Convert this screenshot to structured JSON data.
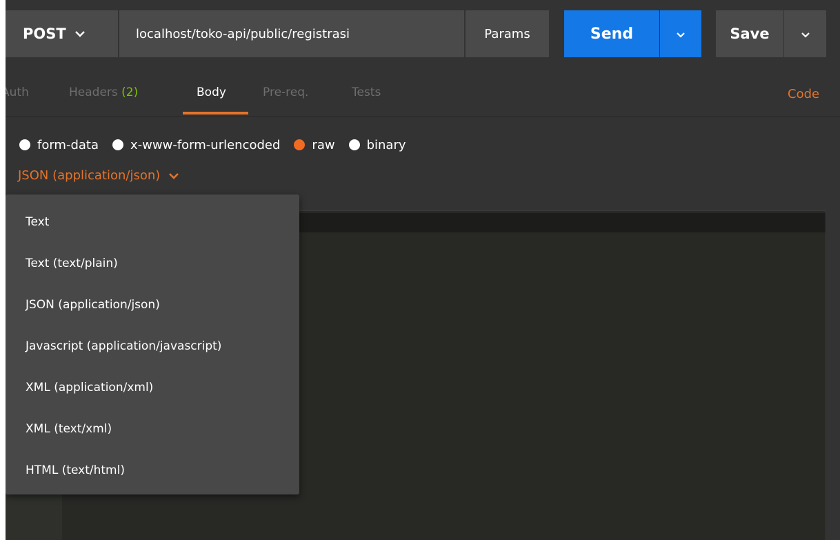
{
  "request": {
    "method": "POST",
    "url": "localhost/toko-api/public/registrasi",
    "params_label": "Params",
    "send_label": "Send",
    "save_label": "Save"
  },
  "tabs": {
    "auth": "Auth",
    "headers": "Headers",
    "headers_count": "(2)",
    "body": "Body",
    "prereq": "Pre-req.",
    "tests": "Tests",
    "code": "Code",
    "active": "Body"
  },
  "body_modes": {
    "options": [
      "form-data",
      "x-www-form-urlencoded",
      "raw",
      "binary"
    ],
    "selected": "raw"
  },
  "content_type": {
    "selected": "JSON (application/json)",
    "options": [
      "Text",
      "Text (text/plain)",
      "JSON (application/json)",
      "Javascript (application/javascript)",
      "XML (application/xml)",
      "XML (text/xml)",
      "HTML (text/html)"
    ]
  },
  "icons": {
    "method_dropdown": "chevron-down-icon",
    "send_dropdown": "chevron-down-icon",
    "save_dropdown": "chevron-down-icon",
    "content_type_dropdown": "chevron-down-icon"
  },
  "colors": {
    "accent_orange": "#e5732a",
    "send_blue": "#1478e6",
    "count_green": "#7ec000",
    "background": "#333333"
  }
}
